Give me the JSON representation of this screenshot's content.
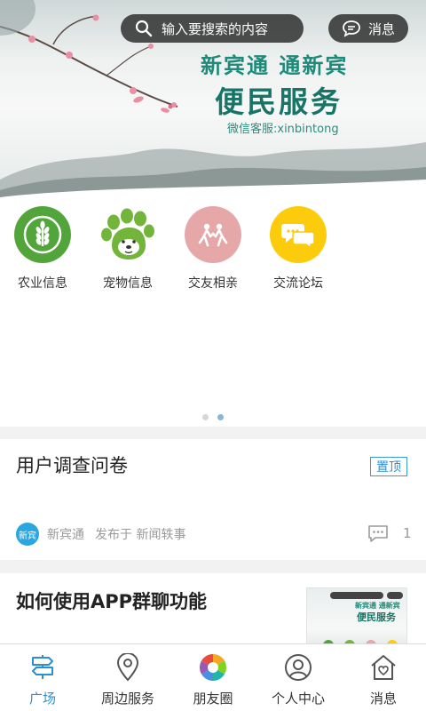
{
  "header": {
    "search_placeholder": "输入要搜索的内容",
    "message_label": "消息"
  },
  "banner": {
    "slogan_line1": "新宾通  通新宾",
    "slogan_line2": "便民服务",
    "slogan_line3": "微信客服:xinbintong"
  },
  "categories": [
    {
      "label": "农业信息",
      "icon": "wheat-icon",
      "color": "#52a53a"
    },
    {
      "label": "宠物信息",
      "icon": "paw-dog-icon",
      "color": "#73b53a"
    },
    {
      "label": "交友相亲",
      "icon": "couple-icon",
      "color": "#e6a7a9"
    },
    {
      "label": "交流论坛",
      "icon": "chat-bubbles-icon",
      "color": "#fccb0c"
    }
  ],
  "pager": {
    "page_count": 2,
    "active_index": 1
  },
  "feed": [
    {
      "title": "用户调查问卷",
      "tag": "置顶",
      "source": "新宾通",
      "published_in": "发布于 新闻轶事",
      "comment_count": "1"
    },
    {
      "title": "如何使用APP群聊功能"
    }
  ],
  "tabbar": [
    {
      "label": "广场",
      "icon": "signpost-icon",
      "active": true
    },
    {
      "label": "周边服务",
      "icon": "location-pin-icon",
      "active": false
    },
    {
      "label": "朋友圈",
      "icon": "aperture-icon",
      "active": false
    },
    {
      "label": "个人中心",
      "icon": "user-icon",
      "active": false
    },
    {
      "label": "消息",
      "icon": "home-heart-icon",
      "active": false
    }
  ],
  "colors": {
    "accent": "#2d8fd3",
    "brand_green": "#177466"
  }
}
